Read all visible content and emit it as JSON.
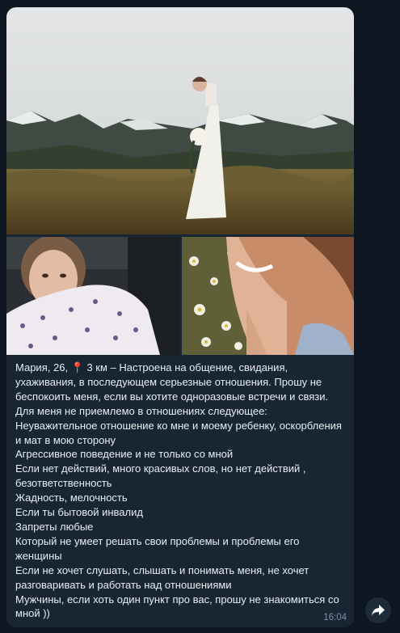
{
  "message": {
    "text": "Мария, 26, 📍 3 км – Настроена на общение, свидания, ухаживания, в последующем серьезные отношения. Прошу не беспокоить меня, если вы хотите одноразовые встречи и связи.\nДля меня не приемлемо в отношениях следующее:\nНеуважительное отношение ко мне и моему ребенку, оскорбления и мат в мою сторону\nАгрессивное поведение и не только со мной\nЕсли нет действий, много красивых слов, но нет действий , безответственность\nЖадность, мелочность\nЕсли ты бытовой инвалид\nЗапреты любые\nКоторый не умеет решать свои проблемы и проблемы его женщины\nЕсли не хочет слушать, слышать и понимать меня, не хочет разговаривать и работать над отношениями\nМужчины, если хоть один пункт про вас, прошу не знакомиться со мной ))",
    "time": "16:04"
  },
  "icons": {
    "forward": "forward-arrow-icon"
  },
  "colors": {
    "chat_background": "#0e1621",
    "bubble_background": "#182533",
    "text": "#e9eef3",
    "timestamp": "#7f91a4"
  }
}
